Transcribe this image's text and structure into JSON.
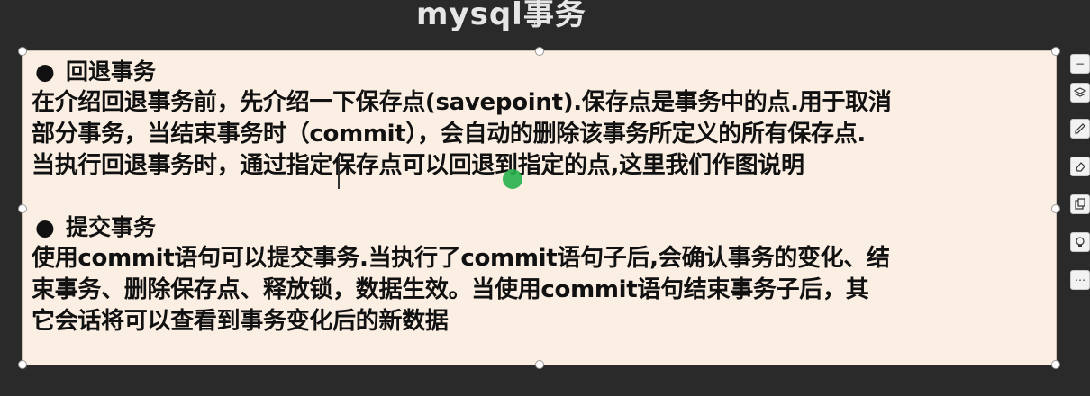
{
  "slide": {
    "title": "mysql事务"
  },
  "sections": [
    {
      "bullet": "●",
      "heading": "回退事务",
      "lines": [
        "在介绍回退事务前，先介绍一下保存点(savepoint).保存点是事务中的点.用于取消",
        "部分事务，当结束事务时（commit），会自动的删除该事务所定义的所有保存点.",
        "当执行回退事务时，通过指定保存点可以回退到指定的点,这里我们作图说明"
      ]
    },
    {
      "bullet": "●",
      "heading": "提交事务",
      "lines": [
        "使用commit语句可以提交事务.当执行了commit语句子后,会确认事务的变化、结",
        "束事务、删除保存点、释放锁，数据生效。当使用commit语句结束事务子后，其",
        "它会话将可以查看到事务变化后的新数据"
      ]
    }
  ],
  "toolbar": {
    "icons": [
      "minus-icon",
      "layers-icon",
      "pen-icon",
      "eraser-icon",
      "copy-icon",
      "lightbulb-icon",
      "more-icon"
    ]
  },
  "colors": {
    "background": "#2a2a2a",
    "textbox": "#fbeee3",
    "cursor": "#27b04b"
  }
}
